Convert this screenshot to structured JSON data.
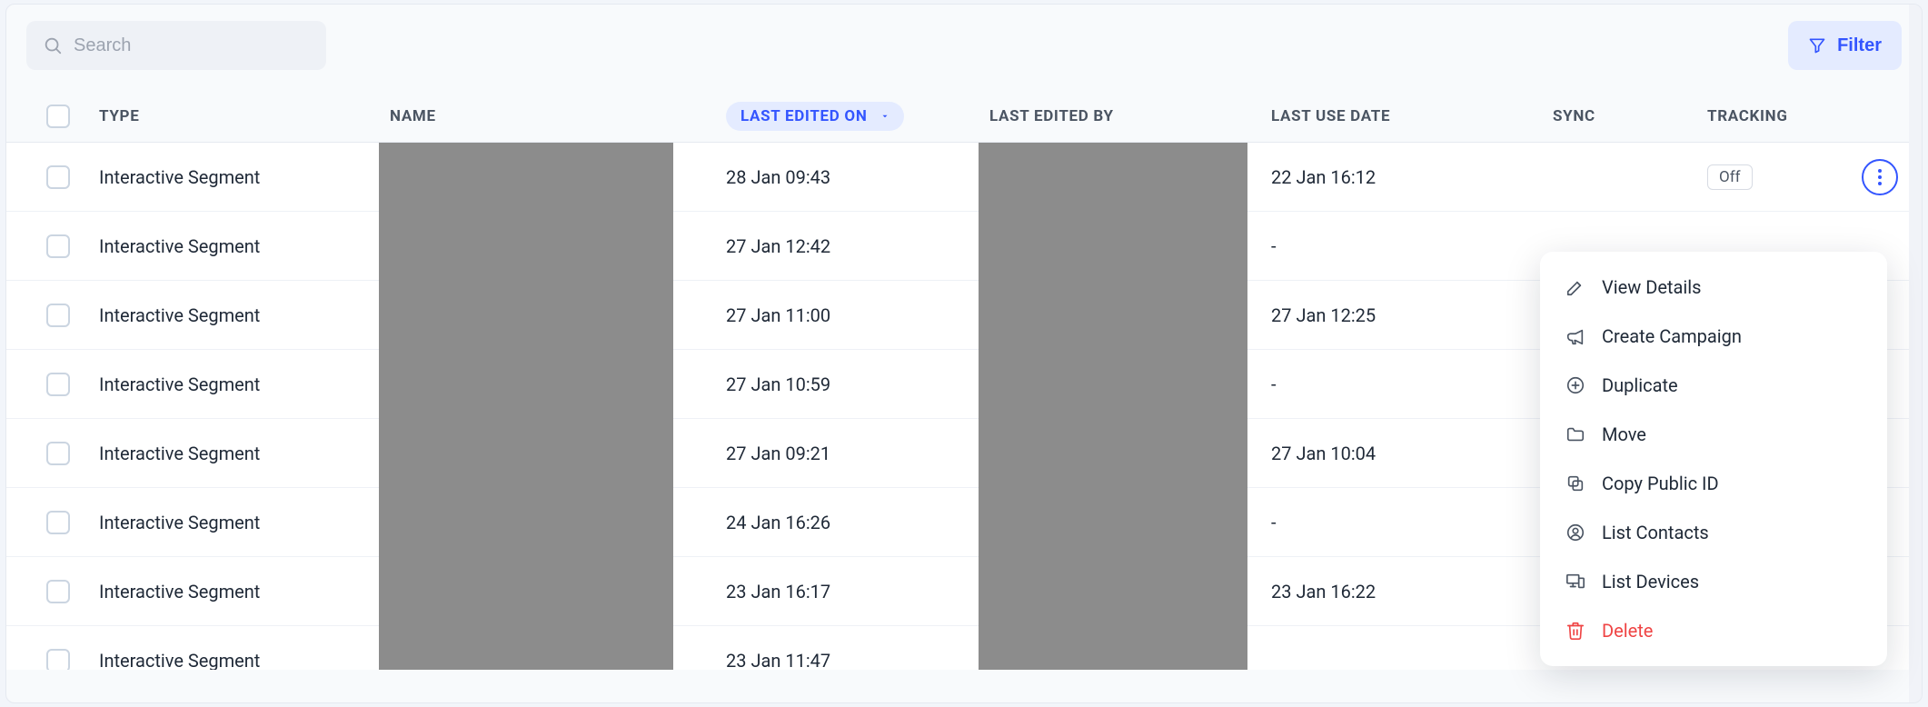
{
  "search": {
    "placeholder": "Search"
  },
  "filter": {
    "label": "Filter"
  },
  "columns": {
    "type": "TYPE",
    "name": "NAME",
    "last_edited_on": "LAST EDITED ON",
    "last_edited_by": "LAST EDITED BY",
    "last_use_date": "LAST USE DATE",
    "sync": "SYNC",
    "tracking": "TRACKING"
  },
  "sorted_column": "last_edited_on",
  "rows": [
    {
      "type": "Interactive Segment",
      "last_edited_on": "28 Jan 09:43",
      "last_use_date": "22 Jan 16:12",
      "tracking": "Off"
    },
    {
      "type": "Interactive Segment",
      "last_edited_on": "27 Jan 12:42",
      "last_use_date": "-"
    },
    {
      "type": "Interactive Segment",
      "last_edited_on": "27 Jan 11:00",
      "last_use_date": "27 Jan 12:25"
    },
    {
      "type": "Interactive Segment",
      "last_edited_on": "27 Jan 10:59",
      "last_use_date": "-"
    },
    {
      "type": "Interactive Segment",
      "last_edited_on": "27 Jan 09:21",
      "last_use_date": "27 Jan 10:04"
    },
    {
      "type": "Interactive Segment",
      "last_edited_on": "24 Jan 16:26",
      "last_use_date": "-"
    },
    {
      "type": "Interactive Segment",
      "last_edited_on": "23 Jan 16:17",
      "last_use_date": "23 Jan 16:22"
    },
    {
      "type": "Interactive Segment",
      "last_edited_on": "23 Jan 11:47",
      "last_use_date": ""
    }
  ],
  "context_menu": {
    "view_details": "View Details",
    "create_campaign": "Create Campaign",
    "duplicate": "Duplicate",
    "move": "Move",
    "copy_public_id": "Copy Public ID",
    "list_contacts": "List Contacts",
    "list_devices": "List Devices",
    "delete": "Delete"
  }
}
